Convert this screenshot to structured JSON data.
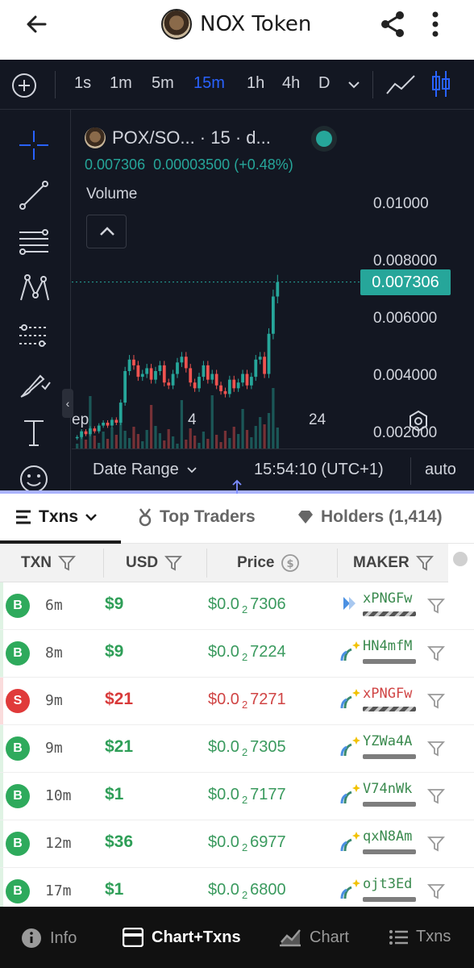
{
  "header": {
    "title": "NOX Token",
    "back_icon": "arrow-left-icon",
    "share_icon": "share-icon",
    "more_icon": "more-vertical-icon"
  },
  "chart_toolbar": {
    "timeframes": [
      "1s",
      "1m",
      "5m",
      "15m",
      "1h",
      "4h",
      "D"
    ],
    "active_timeframe": "15m",
    "accent_color": "#2962ff"
  },
  "chart_legend": {
    "pair": "POX/SO... · 15 · d...",
    "last_price": "0.007306",
    "change_abs": "0.00003500",
    "change_pct": "(+0.48%)",
    "volume_label": "Volume"
  },
  "chart_bottom": {
    "date_range_label": "Date Range",
    "clock": "15:54:10 (UTC+1)",
    "scale_mode": "auto"
  },
  "chart_data": {
    "type": "candlestick",
    "title": "POX/SO... · 15 · d...",
    "xlabel": "",
    "ylabel": "",
    "y_ticks": [
      "0.01000",
      "0.008000",
      "0.006000",
      "0.004000",
      "0.002000"
    ],
    "ylim": [
      0.0015,
      0.0105
    ],
    "x_ticks": [
      "ep",
      "4",
      "24"
    ],
    "current_price": 0.007306,
    "current_price_label": "0.007306",
    "up_color": "#26a69a",
    "down_color": "#ef5350",
    "close_series": [
      0.0019,
      0.0021,
      0.002,
      0.0022,
      0.0021,
      0.0023,
      0.0024,
      0.0023,
      0.0025,
      0.0024,
      0.0031,
      0.0042,
      0.0046,
      0.0044,
      0.004,
      0.0041,
      0.0043,
      0.0039,
      0.0042,
      0.0044,
      0.0038,
      0.0037,
      0.0041,
      0.0045,
      0.0047,
      0.0043,
      0.0038,
      0.0036,
      0.004,
      0.0044,
      0.0039,
      0.0041,
      0.0037,
      0.0035,
      0.0034,
      0.0039,
      0.0036,
      0.0038,
      0.0041,
      0.0037,
      0.004,
      0.0046,
      0.0047,
      0.0041,
      0.0055,
      0.0068,
      0.0073
    ]
  },
  "tabs": [
    {
      "label": "Txns",
      "icon": "list-icon"
    },
    {
      "label": "Top Traders",
      "icon": "medal-icon"
    },
    {
      "label": "Holders (1,414)",
      "icon": "diamond-icon"
    }
  ],
  "table": {
    "columns": [
      "TXN",
      "USD",
      "Price",
      "MAKER"
    ],
    "rows": [
      {
        "type": "B",
        "side": "buy",
        "age": "6m",
        "usd": "$9",
        "price_pre": "$0.0",
        "price_sub": "2",
        "price_post": "7306",
        "maker": "xPNGFw",
        "maker_icon": "new-wallet-icon",
        "bar": "dashed"
      },
      {
        "type": "B",
        "side": "buy",
        "age": "8m",
        "usd": "$9",
        "price_pre": "$0.0",
        "price_sub": "2",
        "price_post": "7224",
        "maker": "HN4mfM",
        "maker_icon": "sparkle-wallet-icon",
        "bar": "solid"
      },
      {
        "type": "S",
        "side": "sell",
        "age": "9m",
        "usd": "$21",
        "price_pre": "$0.0",
        "price_sub": "2",
        "price_post": "7271",
        "maker": "xPNGFw",
        "maker_icon": "sparkle-wallet-icon",
        "bar": "dashed"
      },
      {
        "type": "B",
        "side": "buy",
        "age": "9m",
        "usd": "$21",
        "price_pre": "$0.0",
        "price_sub": "2",
        "price_post": "7305",
        "maker": "YZWa4A",
        "maker_icon": "sparkle-wallet-icon",
        "bar": "solid"
      },
      {
        "type": "B",
        "side": "buy",
        "age": "10m",
        "usd": "$1",
        "price_pre": "$0.0",
        "price_sub": "2",
        "price_post": "7177",
        "maker": "V74nWk",
        "maker_icon": "sparkle-wallet-icon",
        "bar": "solid"
      },
      {
        "type": "B",
        "side": "buy",
        "age": "12m",
        "usd": "$36",
        "price_pre": "$0.0",
        "price_sub": "2",
        "price_post": "6977",
        "maker": "qxN8Am",
        "maker_icon": "sparkle-wallet-icon",
        "bar": "solid"
      },
      {
        "type": "B",
        "side": "buy",
        "age": "17m",
        "usd": "$1",
        "price_pre": "$0.0",
        "price_sub": "2",
        "price_post": "6800",
        "maker": "ojt3Ed",
        "maker_icon": "sparkle-wallet-icon",
        "bar": "solid"
      }
    ]
  },
  "bottom_nav": [
    {
      "label": "Info",
      "icon": "info-icon",
      "active": false
    },
    {
      "label": "Chart+Txns",
      "icon": "chart-txns-icon",
      "active": true
    },
    {
      "label": "Chart",
      "icon": "chart-icon",
      "active": false
    },
    {
      "label": "Txns",
      "icon": "txns-list-icon",
      "active": false
    }
  ]
}
